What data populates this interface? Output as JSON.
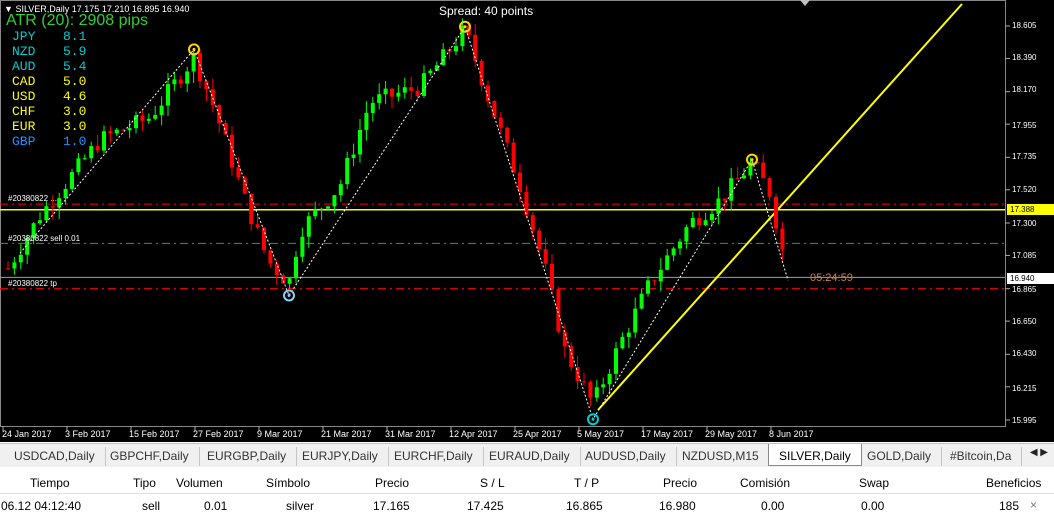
{
  "chart": {
    "symbol_header": "SILVER,Daily  17.175 17.210 16.895 16.940",
    "atr_text": "ATR (20): 2908 pips",
    "spread_text": "Spread: 40 points",
    "countdown": "05:24:59",
    "currency_strength": [
      {
        "name": "JPY",
        "value": "8.1",
        "color": "#00ced1"
      },
      {
        "name": "NZD",
        "value": "5.9",
        "color": "#00ced1"
      },
      {
        "name": "AUD",
        "value": "5.4",
        "color": "#00ced1"
      },
      {
        "name": "CAD",
        "value": "5.0",
        "color": "#ffff00"
      },
      {
        "name": "USD",
        "value": "4.6",
        "color": "#ffff00"
      },
      {
        "name": "CHF",
        "value": "3.0",
        "color": "#ffff00"
      },
      {
        "name": "EUR",
        "value": "3.0",
        "color": "#ffff00"
      },
      {
        "name": "GBP",
        "value": "1.0",
        "color": "#1e90ff"
      }
    ],
    "order_lines": [
      {
        "label": "#20380822 ...",
        "color": "#ff0000",
        "price": 17.425
      },
      {
        "label": "#20380822 sell 0.01",
        "color": "#00c000",
        "price": 17.165
      },
      {
        "label": "#20380822 tp",
        "color": "#ff0000",
        "price": 16.865
      }
    ],
    "current_price_tag": "17.388",
    "bid_price_tag": "16.940",
    "price_axis": [
      "18.605",
      "18.390",
      "18.170",
      "17.955",
      "17.735",
      "17.520",
      "17.300",
      "17.085",
      "16.865",
      "16.650",
      "16.430",
      "16.215",
      "15.995"
    ],
    "date_axis": [
      "24 Jan 2017",
      "3 Feb 2017",
      "15 Feb 2017",
      "27 Feb 2017",
      "9 Mar 2017",
      "21 Mar 2017",
      "31 Mar 2017",
      "12 Apr 2017",
      "25 Apr 2017",
      "5 May 2017",
      "17 May 2017",
      "29 May 2017",
      "8 Jun 2017"
    ],
    "colors": {
      "bull": "#00ff00",
      "bear": "#ff0000",
      "trend": "#ffff00",
      "zigzag": "#ffffff"
    }
  },
  "tabs": [
    {
      "label": "USDCAD,Daily",
      "active": false
    },
    {
      "label": "GBPCHF,Daily",
      "active": false
    },
    {
      "label": "EURGBP,Daily",
      "active": false
    },
    {
      "label": "EURJPY,Daily",
      "active": false
    },
    {
      "label": "EURCHF,Daily",
      "active": false
    },
    {
      "label": "EURAUD,Daily",
      "active": false
    },
    {
      "label": "AUDUSD,Daily",
      "active": false
    },
    {
      "label": "NZDUSD,M15",
      "active": false
    },
    {
      "label": "SILVER,Daily",
      "active": true
    },
    {
      "label": "GOLD,Daily",
      "active": false
    },
    {
      "label": "#Bitcoin,Da",
      "active": false
    }
  ],
  "tab_arrows": "◀ ▶",
  "trade_table": {
    "headers": [
      "Tiempo",
      "Tipo",
      "Volumen",
      "Símbolo",
      "Precio",
      "S / L",
      "T / P",
      "Precio",
      "Comisión",
      "Swap",
      "Beneficios"
    ],
    "row": [
      "06.12 04:12:40",
      "sell",
      "0.01",
      "silver",
      "17.165",
      "17.425",
      "16.865",
      "16.980",
      "0.00",
      "0.00",
      "185"
    ],
    "close_glyph": "×"
  }
}
